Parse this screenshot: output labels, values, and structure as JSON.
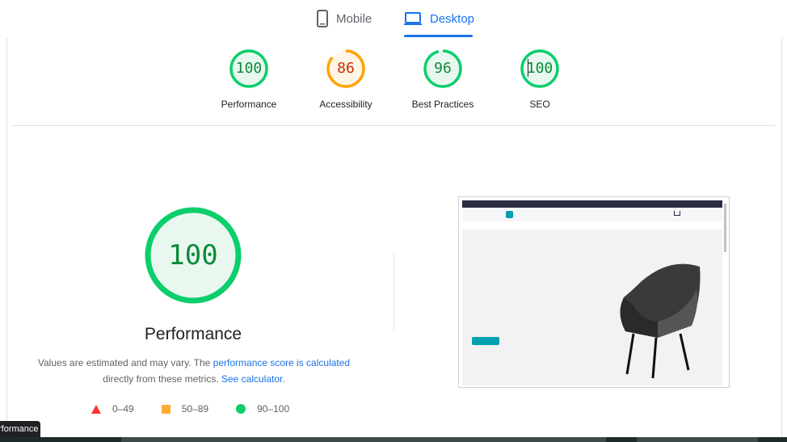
{
  "tabs": [
    {
      "label": "Mobile",
      "icon": "phone-icon",
      "selected": false
    },
    {
      "label": "Desktop",
      "icon": "laptop-icon",
      "selected": true
    }
  ],
  "colors": {
    "pass": "#0cce6b",
    "average": "#ffa400",
    "fail": "#ff3333",
    "accent": "#1a73e8"
  },
  "summary": [
    {
      "label": "Performance",
      "score": "100",
      "fraction": 1.0,
      "rating": "pass"
    },
    {
      "label": "Accessibility",
      "score": "86",
      "fraction": 0.86,
      "rating": "average"
    },
    {
      "label": "Best Practices",
      "score": "96",
      "fraction": 0.96,
      "rating": "pass"
    },
    {
      "label": "SEO",
      "score": "100",
      "fraction": 1.0,
      "rating": "pass"
    }
  ],
  "performance": {
    "score": "100",
    "fraction": 1.0,
    "title": "Performance",
    "desc_pre": "Values are estimated and may vary. The ",
    "desc_link": "performance score is calculated",
    "desc_mid": "directly from these metrics. ",
    "desc_link2": "See calculator",
    "desc_end": "."
  },
  "legend": [
    {
      "range": "0–49",
      "shape": "triangle"
    },
    {
      "range": "50–89",
      "shape": "square"
    },
    {
      "range": "90–100",
      "shape": "circle"
    }
  ],
  "tooltip": "rformance"
}
